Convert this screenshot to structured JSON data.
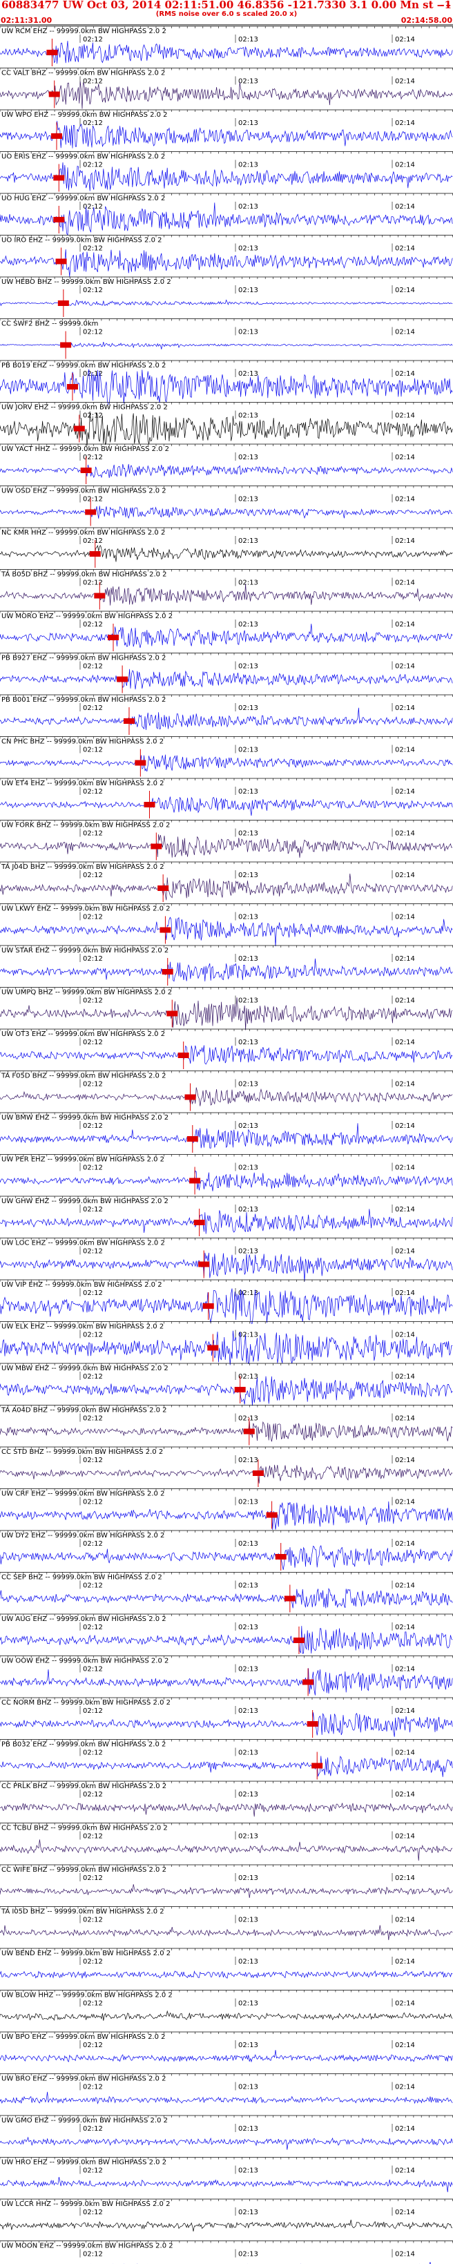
{
  "header": {
    "title": "60883477 UW Oct 03, 2014 02:11:51.00   46.8356 -121.7330  3.1 0.00 Mn st  – – – –",
    "right_mark": "-1",
    "note": "(RMS noise over 6.0 s scaled 20.0 x)",
    "start_time": "02:11:31.00",
    "end_time": "02:14:58.00"
  },
  "time_ticks": [
    "02:12",
    "02:13",
    "02:14"
  ],
  "colors": {
    "blue": "#0000ee",
    "black": "#000000",
    "purple": "#301060",
    "pick_red": "#dd0000"
  },
  "channels": [
    {
      "label": "UW RCM EHZ -- 99999.0km BW  HIGHPASS  2.0  2",
      "color": "blue",
      "amp": 0.45,
      "pick": 0.115
    },
    {
      "label": "CC VALT BHZ -- 99999.0km BW  HIGHPASS  2.0  2",
      "color": "purple",
      "amp": 0.45,
      "pick": 0.12
    },
    {
      "label": "UW WPO EHZ -- 99999.0km BW  HIGHPASS  2.0  2",
      "color": "blue",
      "amp": 0.5,
      "pick": 0.125
    },
    {
      "label": "UO ERIS EHZ -- 99999.0km BW  HIGHPASS  2.0  2",
      "color": "blue",
      "amp": 0.55,
      "pick": 0.13
    },
    {
      "label": "UO HUG EHZ -- 99999.0km BW  HIGHPASS  2.0  2",
      "color": "blue",
      "amp": 0.55,
      "pick": 0.13
    },
    {
      "label": "UO IRO EHZ -- 99999.0km BW  HIGHPASS  2.0  2",
      "color": "blue",
      "amp": 0.55,
      "pick": 0.135
    },
    {
      "label": "UW HEBO BHZ -- 99999.0km BW  HIGHPASS  2.0  2",
      "color": "blue",
      "amp": 0.1,
      "pick": 0.14
    },
    {
      "label": "CC SWF2 BHZ -- 99999.0km",
      "color": "blue",
      "amp": 0.08,
      "pick": 0.145
    },
    {
      "label": "PB B019 EHZ -- 99999.0km BW  HIGHPASS  2.0  2",
      "color": "blue",
      "amp": 0.9,
      "pick": 0.16
    },
    {
      "label": "UW JORV EHZ -- 99999.0km BW  HIGHPASS  2.0  2",
      "color": "black",
      "amp": 0.8,
      "pick": 0.175
    },
    {
      "label": "UW YACT HHZ -- 99999.0km BW  HIGHPASS  2.0  2",
      "color": "blue",
      "amp": 0.3,
      "pick": 0.19
    },
    {
      "label": "UW OSD EHZ -- 99999.0km BW  HIGHPASS  2.0  2",
      "color": "blue",
      "amp": 0.25,
      "pick": 0.2
    },
    {
      "label": "NC KMR HHZ -- 99999.0km BW  HIGHPASS  2.0  2",
      "color": "black",
      "amp": 0.3,
      "pick": 0.21
    },
    {
      "label": "TA B05D BHZ -- 99999.0km BW  HIGHPASS  2.0  2",
      "color": "purple",
      "amp": 0.35,
      "pick": 0.22
    },
    {
      "label": "UW MORO EHZ -- 99999.0km BW  HIGHPASS  2.0  2",
      "color": "blue",
      "amp": 0.45,
      "pick": 0.25
    },
    {
      "label": "PB B927 EHZ -- 99999.0km BW  HIGHPASS  2.0  2",
      "color": "blue",
      "amp": 0.4,
      "pick": 0.27
    },
    {
      "label": "PB B001 EHZ -- 99999.0km BW  HIGHPASS  2.0  2",
      "color": "blue",
      "amp": 0.35,
      "pick": 0.285
    },
    {
      "label": "CN PHC BHZ -- 99999.0km BW  HIGHPASS  2.0  2",
      "color": "blue",
      "amp": 0.3,
      "pick": 0.31
    },
    {
      "label": "UW ET4 EHZ -- 99999.0km BW  HIGHPASS  2.0  2",
      "color": "blue",
      "amp": 0.35,
      "pick": 0.33
    },
    {
      "label": "UW FORK BHZ -- 99999.0km BW  HIGHPASS  2.0  2",
      "color": "purple",
      "amp": 0.45,
      "pick": 0.345
    },
    {
      "label": "TA J04D BHZ -- 99999.0km BW  HIGHPASS  2.0  2",
      "color": "purple",
      "amp": 0.4,
      "pick": 0.36
    },
    {
      "label": "UW LKWY EHZ -- 99999.0km BW  HIGHPASS  2.0  2",
      "color": "blue",
      "amp": 0.45,
      "pick": 0.365
    },
    {
      "label": "UW STAR EHZ -- 99999.0km BW  HIGHPASS  2.0  2",
      "color": "blue",
      "amp": 0.4,
      "pick": 0.37
    },
    {
      "label": "UW UMPQ BHZ -- 99999.0km BW  HIGHPASS  2.0  2",
      "color": "purple",
      "amp": 0.5,
      "pick": 0.38
    },
    {
      "label": "UW OT3 EHZ -- 99999.0km BW  HIGHPASS  2.0  2",
      "color": "blue",
      "amp": 0.4,
      "pick": 0.405
    },
    {
      "label": "TA F05D BHZ -- 99999.0km BW  HIGHPASS  2.0  2",
      "color": "purple",
      "amp": 0.35,
      "pick": 0.42
    },
    {
      "label": "UW BMW EHZ -- 99999.0km BW  HIGHPASS  2.0  2",
      "color": "blue",
      "amp": 0.4,
      "pick": 0.425
    },
    {
      "label": "UW PER EHZ -- 99999.0km BW  HIGHPASS  2.0  2",
      "color": "blue",
      "amp": 0.4,
      "pick": 0.43
    },
    {
      "label": "UW GHW EHZ -- 99999.0km BW  HIGHPASS  2.0  2",
      "color": "blue",
      "amp": 0.45,
      "pick": 0.44
    },
    {
      "label": "UW LOC EHZ -- 99999.0km BW  HIGHPASS  2.0  2",
      "color": "blue",
      "amp": 0.5,
      "pick": 0.45
    },
    {
      "label": "UW VIP EHZ -- 99999.0km BW  HIGHPASS  2.0  2",
      "color": "blue",
      "amp": 0.85,
      "pick": 0.46
    },
    {
      "label": "UW ELK EHZ -- 99999.0km BW  HIGHPASS  2.0  2",
      "color": "blue",
      "amp": 0.85,
      "pick": 0.47
    },
    {
      "label": "UW MBW EHZ -- 99999.0km BW  HIGHPASS  2.0  2",
      "color": "blue",
      "amp": 0.6,
      "pick": 0.53
    },
    {
      "label": "TA A04D BHZ -- 99999.0km BW  HIGHPASS  2.0  2",
      "color": "purple",
      "amp": 0.4,
      "pick": 0.55
    },
    {
      "label": "CC STD BHZ -- 99999.0km BW  HIGHPASS  2.0  2",
      "color": "purple",
      "amp": 0.35,
      "pick": 0.57
    },
    {
      "label": "UW CRF EHZ -- 99999.0km BW  HIGHPASS  2.0  2",
      "color": "blue",
      "amp": 0.5,
      "pick": 0.6
    },
    {
      "label": "UW DY2 EHZ -- 99999.0km BW  HIGHPASS  2.0  2",
      "color": "blue",
      "amp": 0.5,
      "pick": 0.62
    },
    {
      "label": "CC SEP BHZ -- 99999.0km BW  HIGHPASS  2.0  2",
      "color": "blue",
      "amp": 0.45,
      "pick": 0.64
    },
    {
      "label": "UW AUG EHZ -- 99999.0km BW  HIGHPASS  2.0  2",
      "color": "blue",
      "amp": 0.5,
      "pick": 0.66
    },
    {
      "label": "UW OOW EHZ -- 99999.0km BW  HIGHPASS  2.0  2",
      "color": "blue",
      "amp": 0.45,
      "pick": 0.68
    },
    {
      "label": "CC NORM BHZ -- 99999.0km BW  HIGHPASS  2.0  2",
      "color": "blue",
      "amp": 0.45,
      "pick": 0.69
    },
    {
      "label": "PB B032 EHZ -- 99999.0km BW  HIGHPASS  2.0  2",
      "color": "blue",
      "amp": 0.4,
      "pick": 0.7
    },
    {
      "label": "CC PRLK BHZ -- 99999.0km BW  HIGHPASS  2.0  2",
      "color": "purple",
      "amp": 0.45,
      "pick": null
    },
    {
      "label": "CC TCBU BHZ -- 99999.0km BW  HIGHPASS  2.0  2",
      "color": "purple",
      "amp": 0.4,
      "pick": null
    },
    {
      "label": "CC WIFE BHZ -- 99999.0km BW  HIGHPASS  2.0  2",
      "color": "purple",
      "amp": 0.35,
      "pick": null
    },
    {
      "label": "TA I05D BHZ -- 99999.0km BW  HIGHPASS  2.0  2",
      "color": "purple",
      "amp": 0.35,
      "pick": null
    },
    {
      "label": "UW BEND EHZ -- 99999.0km BW  HIGHPASS  2.0  2",
      "color": "blue",
      "amp": 0.35,
      "pick": null
    },
    {
      "label": "UW BLOW HHZ -- 99999.0km BW  HIGHPASS  2.0  2",
      "color": "black",
      "amp": 0.35,
      "pick": null
    },
    {
      "label": "UW BPO EHZ -- 99999.0km BW  HIGHPASS  2.0  2",
      "color": "blue",
      "amp": 0.35,
      "pick": null
    },
    {
      "label": "UW BRO EHZ -- 99999.0km BW  HIGHPASS  2.0  2",
      "color": "blue",
      "amp": 0.35,
      "pick": null
    },
    {
      "label": "UW GMO EHZ -- 99999.0km BW  HIGHPASS  2.0  2",
      "color": "blue",
      "amp": 0.35,
      "pick": null
    },
    {
      "label": "UW HRO EHZ -- 99999.0km BW  HIGHPASS  2.0  2",
      "color": "blue",
      "amp": 0.35,
      "pick": null
    },
    {
      "label": "UW LCCR HHZ -- 99999.0km BW  HIGHPASS  2.0  2",
      "color": "black",
      "amp": 0.35,
      "pick": null
    },
    {
      "label": "UW MOON EHZ -- 99999.0km BW  HIGHPASS  2.0  2",
      "color": "blue",
      "amp": 0.3,
      "pick": null
    }
  ]
}
